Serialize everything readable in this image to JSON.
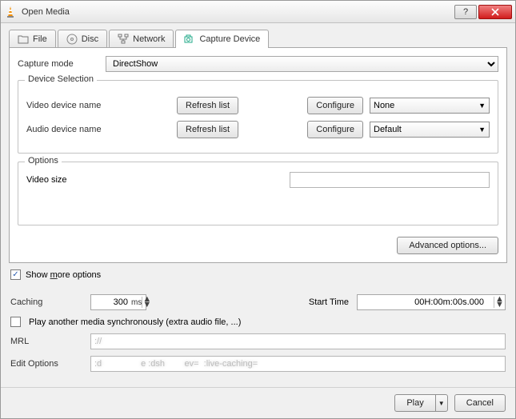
{
  "window": {
    "title": "Open Media"
  },
  "tabs": {
    "file": "File",
    "disc": "Disc",
    "network": "Network",
    "capture": "Capture Device"
  },
  "capture": {
    "mode_label": "Capture mode",
    "mode_value": "DirectShow",
    "device_selection_legend": "Device Selection",
    "video_label": "Video device name",
    "audio_label": "Audio device name",
    "refresh": "Refresh list",
    "configure": "Configure",
    "video_value": "None",
    "audio_value": "Default",
    "options_legend": "Options",
    "video_size_label": "Video size",
    "video_size_value": "",
    "advanced": "Advanced options..."
  },
  "more": {
    "show_label_pre": "Show ",
    "show_label_m": "m",
    "show_label_post": "ore options",
    "caching_label": "Caching",
    "caching_value": "300",
    "caching_unit": "ms",
    "start_label": "Start Time",
    "start_value": "00H:00m:00s.000",
    "sync_label": "Play another media synchronously (extra audio file, ...)",
    "mrl_label": "MRL",
    "mrl_value": "://",
    "edit_label": "Edit Options",
    "edit_value": ":d                e :dsh        ev=  :live-caching="
  },
  "footer": {
    "play": "Play",
    "cancel": "Cancel"
  }
}
